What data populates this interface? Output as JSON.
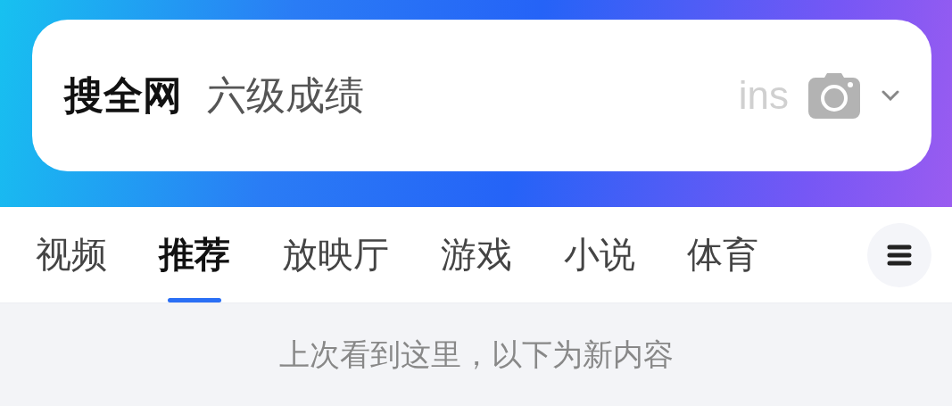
{
  "search": {
    "scope": "搜全网",
    "query": "六级成绩",
    "hint": "ins"
  },
  "tabs": [
    {
      "label": "视频",
      "selected": false
    },
    {
      "label": "推荐",
      "selected": true
    },
    {
      "label": "放映厅",
      "selected": false
    },
    {
      "label": "游戏",
      "selected": false
    },
    {
      "label": "小说",
      "selected": false
    },
    {
      "label": "体育",
      "selected": false
    }
  ],
  "notice": "上次看到这里，以下为新内容"
}
